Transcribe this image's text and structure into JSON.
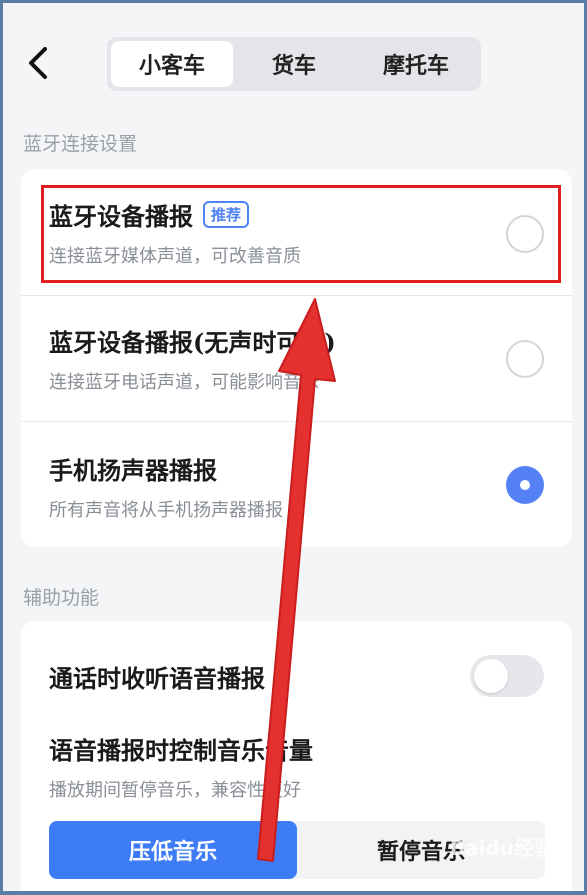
{
  "header": {
    "tabs": [
      {
        "label": "小客车",
        "active": true
      },
      {
        "label": "货车",
        "active": false
      },
      {
        "label": "摩托车",
        "active": false
      }
    ]
  },
  "bluetooth_section": {
    "title": "蓝牙连接设置",
    "options": [
      {
        "title": "蓝牙设备播报",
        "badge": "推荐",
        "subtitle": "连接蓝牙媒体声道，可改善音质",
        "selected": false
      },
      {
        "title": "蓝牙设备播报(无声时可选)",
        "subtitle": "连接蓝牙电话声道，可能影响音乐",
        "selected": false
      },
      {
        "title": "手机扬声器播报",
        "subtitle": "所有声音将从手机扬声器播报",
        "selected": true
      }
    ]
  },
  "assist_section": {
    "title": "辅助功能",
    "call_listen": {
      "title": "通话时收听语音播报",
      "enabled": false
    },
    "music_control": {
      "title": "语音播报时控制音乐音量",
      "subtitle": "播放期间暂停音乐，兼容性更好",
      "buttons": [
        {
          "label": "压低音乐",
          "active": true
        },
        {
          "label": "暂停音乐",
          "active": false
        }
      ]
    }
  },
  "watermark": "Baidu经验",
  "colors": {
    "accent": "#3d7cf6",
    "highlight": "#e02020",
    "radio_checked": "#5481f4"
  }
}
